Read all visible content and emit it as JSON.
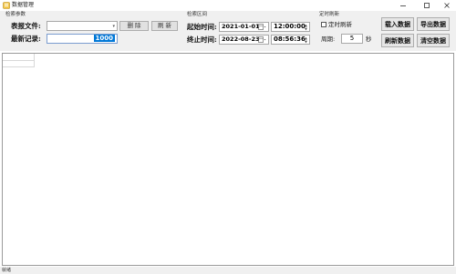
{
  "window": {
    "title": "数据管理"
  },
  "groups": {
    "query_params": "检索参数",
    "query_range": "检索区间",
    "timed_refresh": "定时刷新"
  },
  "query": {
    "report_file_label": "表报文件:",
    "report_file_value": "",
    "latest_record_label": "最新记录:",
    "latest_record_value": "1000",
    "delete_label": "删 除",
    "refresh_small_label": "刷 新"
  },
  "range": {
    "start_label": "起始时间:",
    "start_date": "2021-01-01",
    "start_time": "12:00:00",
    "end_label": "终止时间:",
    "end_date": "2022-08-23",
    "end_time": "08:56:36"
  },
  "refresh": {
    "checkbox_label": "定时刷新",
    "checked": false,
    "period_label": "周期:",
    "period_value": "5",
    "period_unit": "秒"
  },
  "actions": {
    "load": "载入数据",
    "export": "导出数据",
    "refresh": "刷新数据",
    "clear": "清空数据"
  },
  "status": {
    "text": "就绪"
  }
}
